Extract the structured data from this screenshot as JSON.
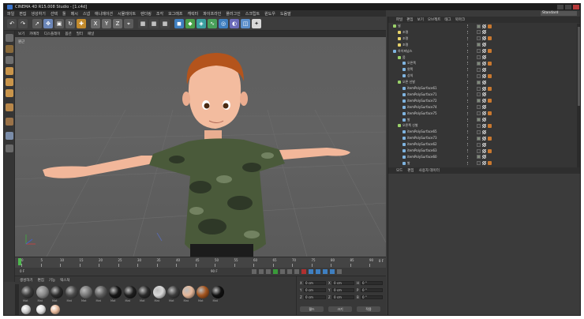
{
  "window": {
    "title": "CINEMA 4D R15.008 Studio - [1.c4d]"
  },
  "layout": {
    "label": "Standard"
  },
  "menubar": [
    "파일",
    "편집",
    "생성하기",
    "선택",
    "툴",
    "메시",
    "스냅",
    "애니메이션",
    "시뮬레이트",
    "렌더링",
    "조각",
    "모그래프",
    "캐릭터",
    "파이프라인",
    "플러그인",
    "스크립트",
    "윈도우",
    "도움말"
  ],
  "viewport": {
    "label": "원근",
    "menu": [
      "보기",
      "카메라",
      "디스플레이",
      "옵션",
      "필터",
      "패널"
    ]
  },
  "timeline": {
    "ticks": [
      "0",
      "5",
      "10",
      "15",
      "20",
      "25",
      "30",
      "35",
      "40",
      "45",
      "50",
      "55",
      "60",
      "65",
      "70",
      "75",
      "80",
      "85",
      "90"
    ],
    "end_label": "0 F",
    "start_field": "0 F",
    "end_field": "90 F"
  },
  "materials": {
    "menu": [
      "생성하기",
      "편집",
      "기능",
      "텍스처"
    ],
    "swatches": [
      {
        "label": "Mat",
        "color": "#3a3a3a"
      },
      {
        "label": "Mat",
        "color": "#8a8a8a"
      },
      {
        "label": "Mat",
        "color": "#2b2b2b"
      },
      {
        "label": "Mat",
        "color": "#4a4a4a"
      },
      {
        "label": "Mat",
        "color": "#777"
      },
      {
        "label": "Mat",
        "color": "#5e5e5e"
      },
      {
        "label": "Mat",
        "color": "#161616"
      },
      {
        "label": "Mat",
        "color": "#1f1f1f"
      },
      {
        "label": "Mat",
        "color": "#2a2a2a"
      },
      {
        "label": "Mat",
        "color": "#d8d8d8"
      },
      {
        "label": "Mat",
        "color": "#3c3c3c"
      },
      {
        "label": "Mat",
        "color": "#e6b89a"
      },
      {
        "label": "Mat",
        "color": "#a4551f"
      },
      {
        "label": "Mat",
        "color": "#111"
      }
    ]
  },
  "coordinates": {
    "rows": [
      {
        "a": "X",
        "av": "0 cm",
        "b": "X",
        "bv": "0 cm",
        "c": "H",
        "cv": "0 °"
      },
      {
        "a": "Y",
        "av": "0 cm",
        "b": "Y",
        "bv": "0 cm",
        "c": "P",
        "cv": "0 °"
      },
      {
        "a": "Z",
        "av": "0 cm",
        "b": "Z",
        "bv": "0 cm",
        "c": "B",
        "cv": "0 °"
      }
    ],
    "dropdown1": "월드",
    "dropdown2": "크기",
    "apply": "적용"
  },
  "object_manager": {
    "menu": [
      "파일",
      "편집",
      "보기",
      "오브젝트",
      "태그",
      "북마크"
    ],
    "rows": [
      {
        "name": "널",
        "depth": 0,
        "icon": "#9ad16a"
      },
      {
        "name": "조명",
        "depth": 1,
        "icon": "#e8d36a"
      },
      {
        "name": "조명",
        "depth": 1,
        "icon": "#e8d36a"
      },
      {
        "name": "조명",
        "depth": 1,
        "icon": "#e8d36a"
      },
      {
        "name": "하이퍼넙스",
        "depth": 0,
        "icon": "#7fb4e0"
      },
      {
        "name": "몸",
        "depth": 1,
        "icon": "#9ad16a"
      },
      {
        "name": "오른쪽",
        "depth": 2,
        "icon": "#7fb4e0"
      },
      {
        "name": "왼쪽",
        "depth": 2,
        "icon": "#7fb4e0"
      },
      {
        "name": "상의",
        "depth": 2,
        "icon": "#7fb4e0"
      },
      {
        "name": "오른 신발",
        "depth": 1,
        "icon": "#9ad16a"
      },
      {
        "name": "itemPolySurface61",
        "depth": 2,
        "icon": "#7fb4e0"
      },
      {
        "name": "itemPolySurface71",
        "depth": 2,
        "icon": "#7fb4e0"
      },
      {
        "name": "itemPolySurface72",
        "depth": 2,
        "icon": "#7fb4e0"
      },
      {
        "name": "itemPolySurface74",
        "depth": 2,
        "icon": "#7fb4e0"
      },
      {
        "name": "itemPolySurface75",
        "depth": 2,
        "icon": "#7fb4e0"
      },
      {
        "name": "발",
        "depth": 2,
        "icon": "#7fb4e0"
      },
      {
        "name": "오른쪽 신발",
        "depth": 1,
        "icon": "#9ad16a"
      },
      {
        "name": "itemPolySurface65",
        "depth": 2,
        "icon": "#7fb4e0"
      },
      {
        "name": "itemPolySurface73",
        "depth": 2,
        "icon": "#7fb4e0"
      },
      {
        "name": "itemPolySurface62",
        "depth": 2,
        "icon": "#7fb4e0"
      },
      {
        "name": "itemPolySurface63",
        "depth": 2,
        "icon": "#7fb4e0"
      },
      {
        "name": "itemPolySurface60",
        "depth": 2,
        "icon": "#7fb4e0"
      },
      {
        "name": "발",
        "depth": 2,
        "icon": "#7fb4e0"
      }
    ]
  },
  "attributes": {
    "menu": [
      "모드",
      "편집",
      "사용자 데이터"
    ]
  }
}
